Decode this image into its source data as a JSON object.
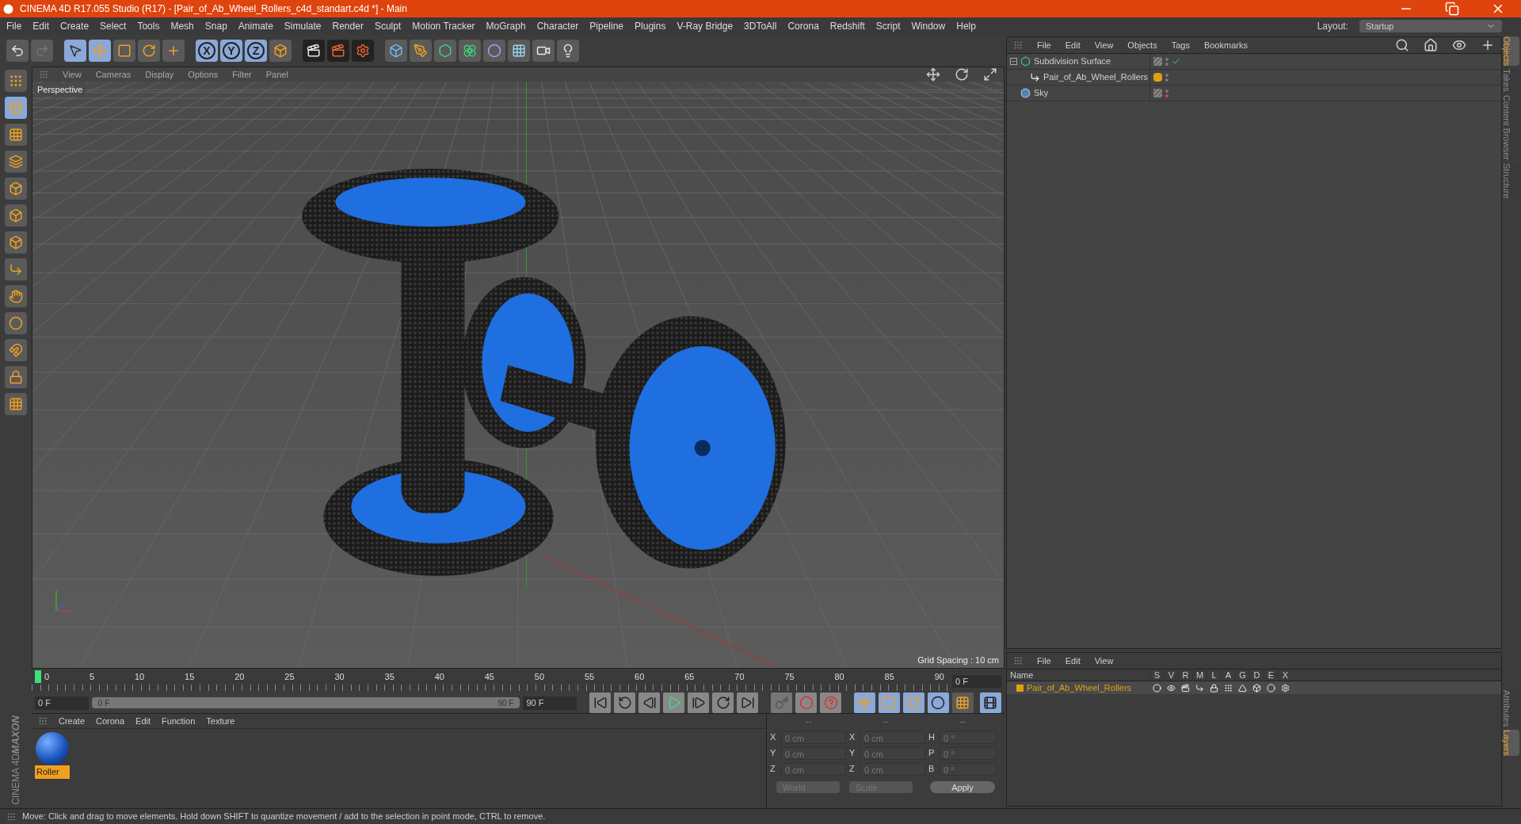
{
  "window": {
    "title": "CINEMA 4D R17.055 Studio (R17) - [Pair_of_Ab_Wheel_Rollers_c4d_standart.c4d *] - Main"
  },
  "menu": [
    "File",
    "Edit",
    "Create",
    "Select",
    "Tools",
    "Mesh",
    "Snap",
    "Animate",
    "Simulate",
    "Render",
    "Sculpt",
    "Motion Tracker",
    "MoGraph",
    "Character",
    "Pipeline",
    "Plugins",
    "V-Ray Bridge",
    "3DToAll",
    "Corona",
    "Redshift",
    "Script",
    "Window",
    "Help"
  ],
  "layout": {
    "label": "Layout:",
    "value": "Startup"
  },
  "axis_buttons": [
    {
      "label": "X",
      "selected": true
    },
    {
      "label": "Y",
      "selected": true
    },
    {
      "label": "Z",
      "selected": true
    }
  ],
  "viewport": {
    "menu": [
      "View",
      "Cameras",
      "Display",
      "Options",
      "Filter",
      "Panel"
    ],
    "camera": "Perspective",
    "grid_spacing": "Grid Spacing : 10 cm"
  },
  "timeline": {
    "ticks": [
      "0",
      "5",
      "10",
      "15",
      "20",
      "25",
      "30",
      "35",
      "40",
      "45",
      "50",
      "55",
      "60",
      "65",
      "70",
      "75",
      "80",
      "85",
      "90"
    ],
    "level": 0,
    "current": "0 F",
    "start": "0 F",
    "range": {
      "start": "0 F",
      "end": "90 F",
      "level": 1
    },
    "end": "90 F"
  },
  "materials": {
    "menu": [
      "Create",
      "Corona",
      "Edit",
      "Function",
      "Texture"
    ],
    "items": [
      {
        "name": "Roller",
        "selected": true
      }
    ]
  },
  "coordinates": {
    "headers": [
      "--",
      "--",
      "--"
    ],
    "rows": [
      {
        "axis": "X",
        "pos": "0 cm",
        "axis2": "X",
        "size": "0 cm",
        "rot_axis": "H",
        "rot": "0 °"
      },
      {
        "axis": "Y",
        "pos": "0 cm",
        "axis2": "Y",
        "size": "0 cm",
        "rot_axis": "P",
        "rot": "0 °"
      },
      {
        "axis": "Z",
        "pos": "0 cm",
        "axis2": "Z",
        "size": "0 cm",
        "rot_axis": "B",
        "rot": "0 °"
      }
    ],
    "mode": "World",
    "transform": "Scale",
    "apply": "Apply"
  },
  "status_bar": "Move: Click and drag to move elements. Hold down SHIFT to quantize movement / add to the selection in point mode, CTRL to remove.",
  "objects": {
    "menu": [
      "File",
      "Edit",
      "View",
      "Objects",
      "Tags",
      "Bookmarks"
    ],
    "tree": [
      {
        "name": "Subdivision Surface",
        "kind": "subdivision",
        "expanded": true,
        "check": true,
        "render_off": false,
        "children": [
          {
            "name": "Pair_of_Ab_Wheel_Rollers",
            "kind": "null",
            "expanded": false,
            "check": false,
            "render_off": false,
            "color": "#e0a010"
          }
        ]
      },
      {
        "name": "Sky",
        "kind": "sky",
        "expanded": false,
        "check": false,
        "render_off": true
      }
    ]
  },
  "layers": {
    "menu": [
      "File",
      "Edit",
      "View"
    ],
    "columns": [
      "Name",
      "S",
      "V",
      "R",
      "M",
      "L",
      "A",
      "G",
      "D",
      "E",
      "X"
    ],
    "rows": [
      {
        "name": "Pair_of_Ab_Wheel_Rollers",
        "color": "#e0a010"
      }
    ]
  },
  "side_tabs_top": [
    {
      "label": "Objects",
      "selected": true
    },
    {
      "label": "Takes",
      "selected": false
    },
    {
      "label": "Content Browser",
      "selected": false
    },
    {
      "label": "Structure",
      "selected": false
    }
  ],
  "side_tabs_bottom": [
    {
      "label": "Attributes",
      "selected": false
    },
    {
      "label": "Layers",
      "selected": true
    }
  ],
  "logo": {
    "brand": "MAXON",
    "product": "CINEMA 4D"
  }
}
